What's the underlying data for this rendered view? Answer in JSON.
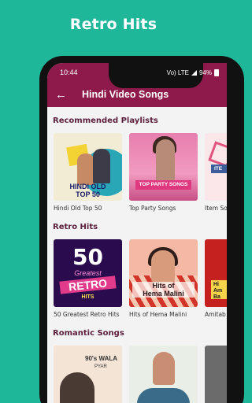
{
  "promo": {
    "title": "Retro Hits"
  },
  "status_bar": {
    "time": "10:44",
    "icons_text": "Vo) LTE",
    "battery": "94%"
  },
  "app_bar": {
    "back_icon": "arrow-left-icon",
    "title": "Hindi Video Songs"
  },
  "sections": [
    {
      "title": "Recommended Playlists",
      "items": [
        {
          "caption": "Hindi Old Top 50",
          "art_text": [
            "HINDI OLD",
            "TOP 50"
          ]
        },
        {
          "caption": "Top Party Songs",
          "art_text": [
            "TOP PARTY SONGS"
          ]
        },
        {
          "caption": "Item So",
          "art_text": [
            "ITE"
          ]
        }
      ]
    },
    {
      "title": "Retro Hits",
      "items": [
        {
          "caption": "50 Greatest Retro Hits",
          "art_text": [
            "50",
            "Greatest",
            "RETRO",
            "HITS"
          ]
        },
        {
          "caption": "Hits of Hema Malini",
          "art_text": [
            "Hits of",
            "Hema Malini"
          ]
        },
        {
          "caption": "Amitab",
          "art_text": [
            "Hi",
            "Am",
            "Ba"
          ]
        }
      ]
    },
    {
      "title": "Romantic Songs",
      "items": [
        {
          "caption": "",
          "art_text": [
            "90's WALA",
            "PYAR"
          ]
        },
        {
          "caption": "",
          "art_text": []
        },
        {
          "caption": "",
          "art_text": []
        }
      ]
    }
  ],
  "colors": {
    "background": "#1fb79a",
    "app_bar": "#8d1a4a",
    "screen": "#f3f3f3"
  }
}
